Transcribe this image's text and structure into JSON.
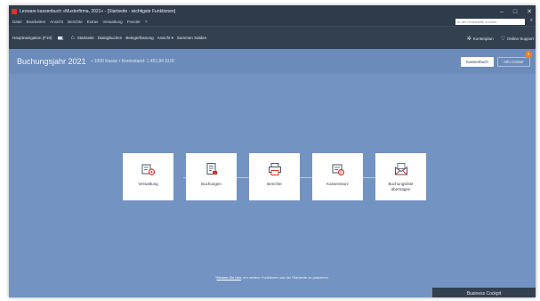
{
  "window": {
    "title": "Lexware kassenbuch «Musterfirma, 2021» - [Startseite - wichtigste Funktionen]",
    "controls": [
      "–",
      "□",
      "✕"
    ]
  },
  "menu": {
    "items": [
      "Datei",
      "Bearbeiten",
      "Ansicht",
      "Berichte",
      "Extras",
      "Verwaltung",
      "Fenster",
      "?"
    ],
    "search_placeholder": "In der Onlinehilfe suchen"
  },
  "nav": {
    "main_label": "Hauptnavigation (F10)",
    "links": [
      "Startseite",
      "Dialogbuchen",
      "Belegerfassung",
      "Ansicht ▾",
      "Summen Salden"
    ],
    "kontenplan": "Kontenplan",
    "online_support": "Online Support"
  },
  "subheader": {
    "year_label": "Buchungsjahr 2021",
    "info": "• 1000 Kasse • Kontostand: 1.451,84 EUR",
    "kassenbuch_button": "Kassenbuch",
    "infocenter_button": "Info Center",
    "badge_count": "1"
  },
  "tiles": [
    {
      "label": "Verwaltung",
      "icon": "settings-icon"
    },
    {
      "label": "Buchungen",
      "icon": "bookings-icon"
    },
    {
      "label": "Berichte",
      "icon": "printer-icon"
    },
    {
      "label": "Kassensturz",
      "icon": "cash-count-icon"
    },
    {
      "label": "Buchungsliste übertragen",
      "icon": "transfer-envelope-icon"
    }
  ],
  "hint": {
    "prefix": "*",
    "link": "Klicken Sie hier",
    "text": "um weitere Funktionen auf der Startseite zu platzieren."
  },
  "cockpit_button": "Business Cockpit",
  "colors": {
    "titlebar": "#2f3a4b",
    "navbar": "#33404f",
    "content": "#7393c2",
    "badge": "#f07d1c",
    "icon_accent": "#d9322b"
  }
}
